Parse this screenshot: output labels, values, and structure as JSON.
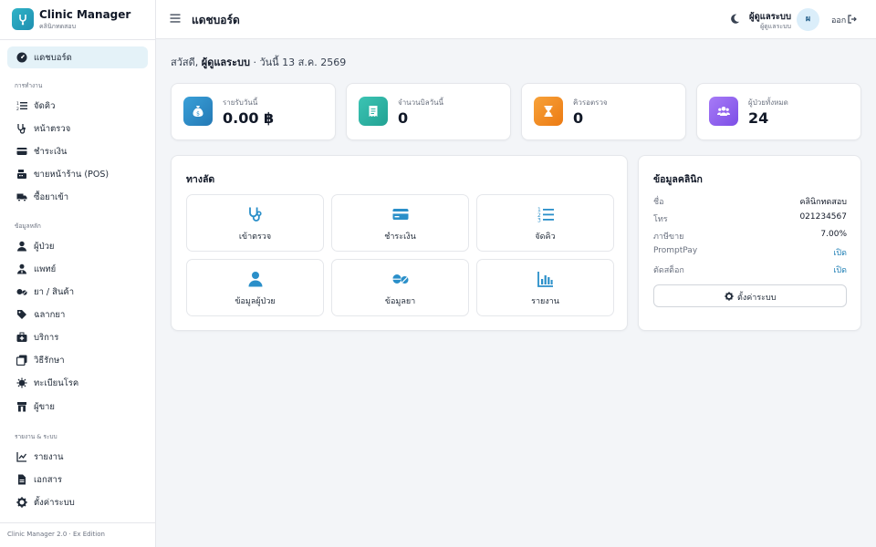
{
  "brand": {
    "title": "Clinic Manager",
    "subtitle": "คลินิกทดสอบ"
  },
  "sidebar": {
    "active": "แดชบอร์ด",
    "sections": [
      {
        "label": "การทำงาน",
        "items": [
          "จัดคิว",
          "หน้าตรวจ",
          "ชำระเงิน",
          "ขายหน้าร้าน (POS)",
          "ซื้อยาเข้า"
        ]
      },
      {
        "label": "ข้อมูลหลัก",
        "items": [
          "ผู้ป่วย",
          "แพทย์",
          "ยา / สินค้า",
          "ฉลากยา",
          "บริการ",
          "วิธีรักษา",
          "ทะเบียนโรค",
          "ผู้ขาย"
        ]
      },
      {
        "label": "รายงาน & ระบบ",
        "items": [
          "รายงาน",
          "เอกสาร",
          "ตั้งค่าระบบ"
        ]
      }
    ],
    "footer": "Clinic Manager 2.0 · Ex Edition"
  },
  "topbar": {
    "title": "แดชบอร์ด",
    "user_name": "ผู้ดูแลระบบ",
    "user_role": "ผู้ดูแลระบบ",
    "avatar_initial": "ผ",
    "logout_label": "ออก"
  },
  "greeting": {
    "prefix": "สวัสดี, ",
    "name": "ผู้ดูแลระบบ",
    "date": " · วันนี้ 13 ส.ค. 2569"
  },
  "stats": [
    {
      "label": "รายรับวันนี้",
      "value": "0.00 ฿",
      "color": "#2a8fc9",
      "icon": "money-bag-icon"
    },
    {
      "label": "จำนวนบิลวันนี้",
      "value": "0",
      "color": "#2bb3a3",
      "icon": "receipt-icon"
    },
    {
      "label": "คิวรอตรวจ",
      "value": "0",
      "color": "#f2891f",
      "icon": "hourglass-icon"
    },
    {
      "label": "ผู้ป่วยทั้งหมด",
      "value": "24",
      "color": "#8b5cf6",
      "icon": "users-icon"
    }
  ],
  "shortcuts": {
    "title": "ทางลัด",
    "items": [
      {
        "label": "เข้าตรวจ",
        "icon": "stethoscope-icon"
      },
      {
        "label": "ชำระเงิน",
        "icon": "credit-card-icon"
      },
      {
        "label": "จัดคิว",
        "icon": "ordered-list-icon"
      },
      {
        "label": "ข้อมูลผู้ป่วย",
        "icon": "user-icon"
      },
      {
        "label": "ข้อมูลยา",
        "icon": "pills-icon"
      },
      {
        "label": "รายงาน",
        "icon": "bar-chart-icon"
      }
    ]
  },
  "clinic_info": {
    "title": "ข้อมูลคลินิก",
    "rows": [
      {
        "key": "ชื่อ",
        "value": "คลินิกทดสอบ"
      },
      {
        "key": "โทร",
        "value": "021234567"
      },
      {
        "key": "ภาษีขาย",
        "value": "7.00%"
      },
      {
        "key": "PromptPay",
        "value": "เปิด"
      },
      {
        "key": "ตัดสต็อก",
        "value": "เปิด"
      }
    ],
    "settings_label": "ตั้งค่าระบบ"
  },
  "colors": {
    "accent": "#1f7fb5",
    "active_bg": "#e4f2f8"
  }
}
